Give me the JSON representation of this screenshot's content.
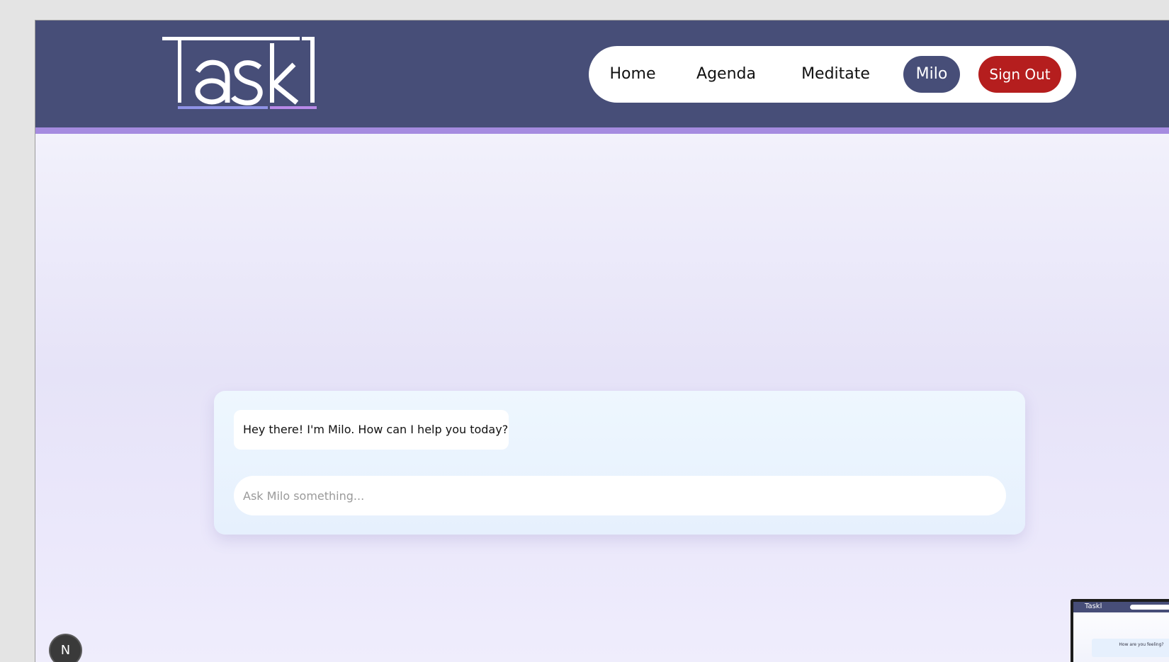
{
  "header": {
    "logo_text": "Taskl",
    "colors": {
      "header_bg": "#474e78",
      "accent_bar": "#a58be0"
    }
  },
  "nav": {
    "items": [
      {
        "label": "Home"
      },
      {
        "label": "Agenda"
      },
      {
        "label": "Meditate"
      },
      {
        "label": "Milo",
        "active": true
      },
      {
        "label": "Sign Out",
        "danger": true
      }
    ],
    "colors": {
      "active_bg": "#474e78",
      "signout_bg": "#b51e1e"
    }
  },
  "chat": {
    "messages": [
      {
        "from": "Milo",
        "text": "Hey there! I'm Milo. How can I help you today?"
      }
    ],
    "input_placeholder": "Ask Milo something..."
  },
  "dev_badge": {
    "letter": "N"
  },
  "preview_thumbnail": {
    "logo_text": "Taskl",
    "caption": "How are you feeling?"
  }
}
